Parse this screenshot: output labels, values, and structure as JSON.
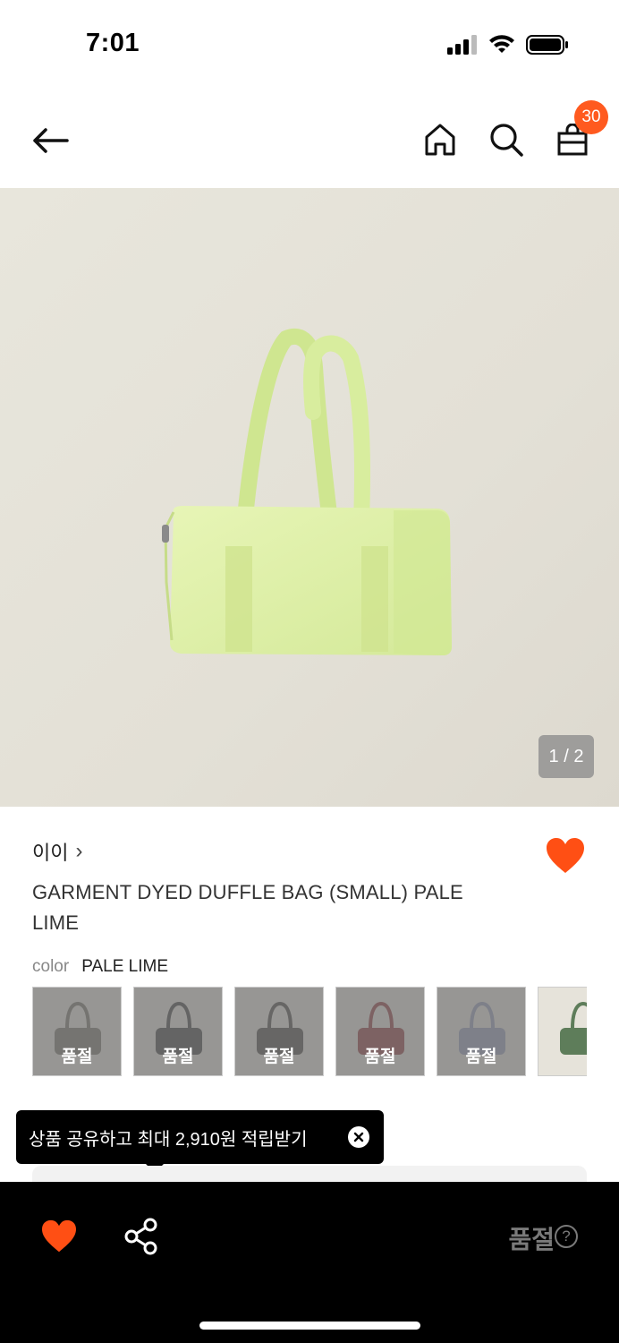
{
  "status_bar": {
    "time": "7:01"
  },
  "nav": {
    "back_icon": "arrow-left-icon",
    "home_icon": "home-icon",
    "search_icon": "search-icon",
    "cart_icon": "shopping-bag-icon",
    "cart_count": "30"
  },
  "gallery": {
    "counter": "1 / 2"
  },
  "product": {
    "brand": "이이",
    "brand_chevron": "›",
    "name": "GARMENT DYED DUFFLE BAG (SMALL) PALE LIME",
    "favorite_icon": "heart-icon",
    "color_label": "color",
    "color_value": "PALE LIME"
  },
  "swatches": [
    {
      "bag_color": "#6e6a5e",
      "status": "품절"
    },
    {
      "bag_color": "#2f2f2f",
      "status": "품절"
    },
    {
      "bag_color": "#3a3834",
      "status": "품절"
    },
    {
      "bag_color": "#8a2a2c",
      "status": "품절"
    },
    {
      "bag_color": "#8b93b4",
      "status": "품절"
    },
    {
      "bag_color": "#5e7d5a",
      "status": ""
    }
  ],
  "tooltip": {
    "text": "상품 공유하고 최대 2,910원 적립받기",
    "close_icon": "close-circle-icon"
  },
  "bottom_bar": {
    "wishlist_icon": "heart-icon",
    "share_icon": "share-icon",
    "status": "품절",
    "help": "?"
  },
  "colors": {
    "accent": "#ff5a1f",
    "bag": "#dff0a8",
    "hero_bg": "#e6e3da"
  }
}
